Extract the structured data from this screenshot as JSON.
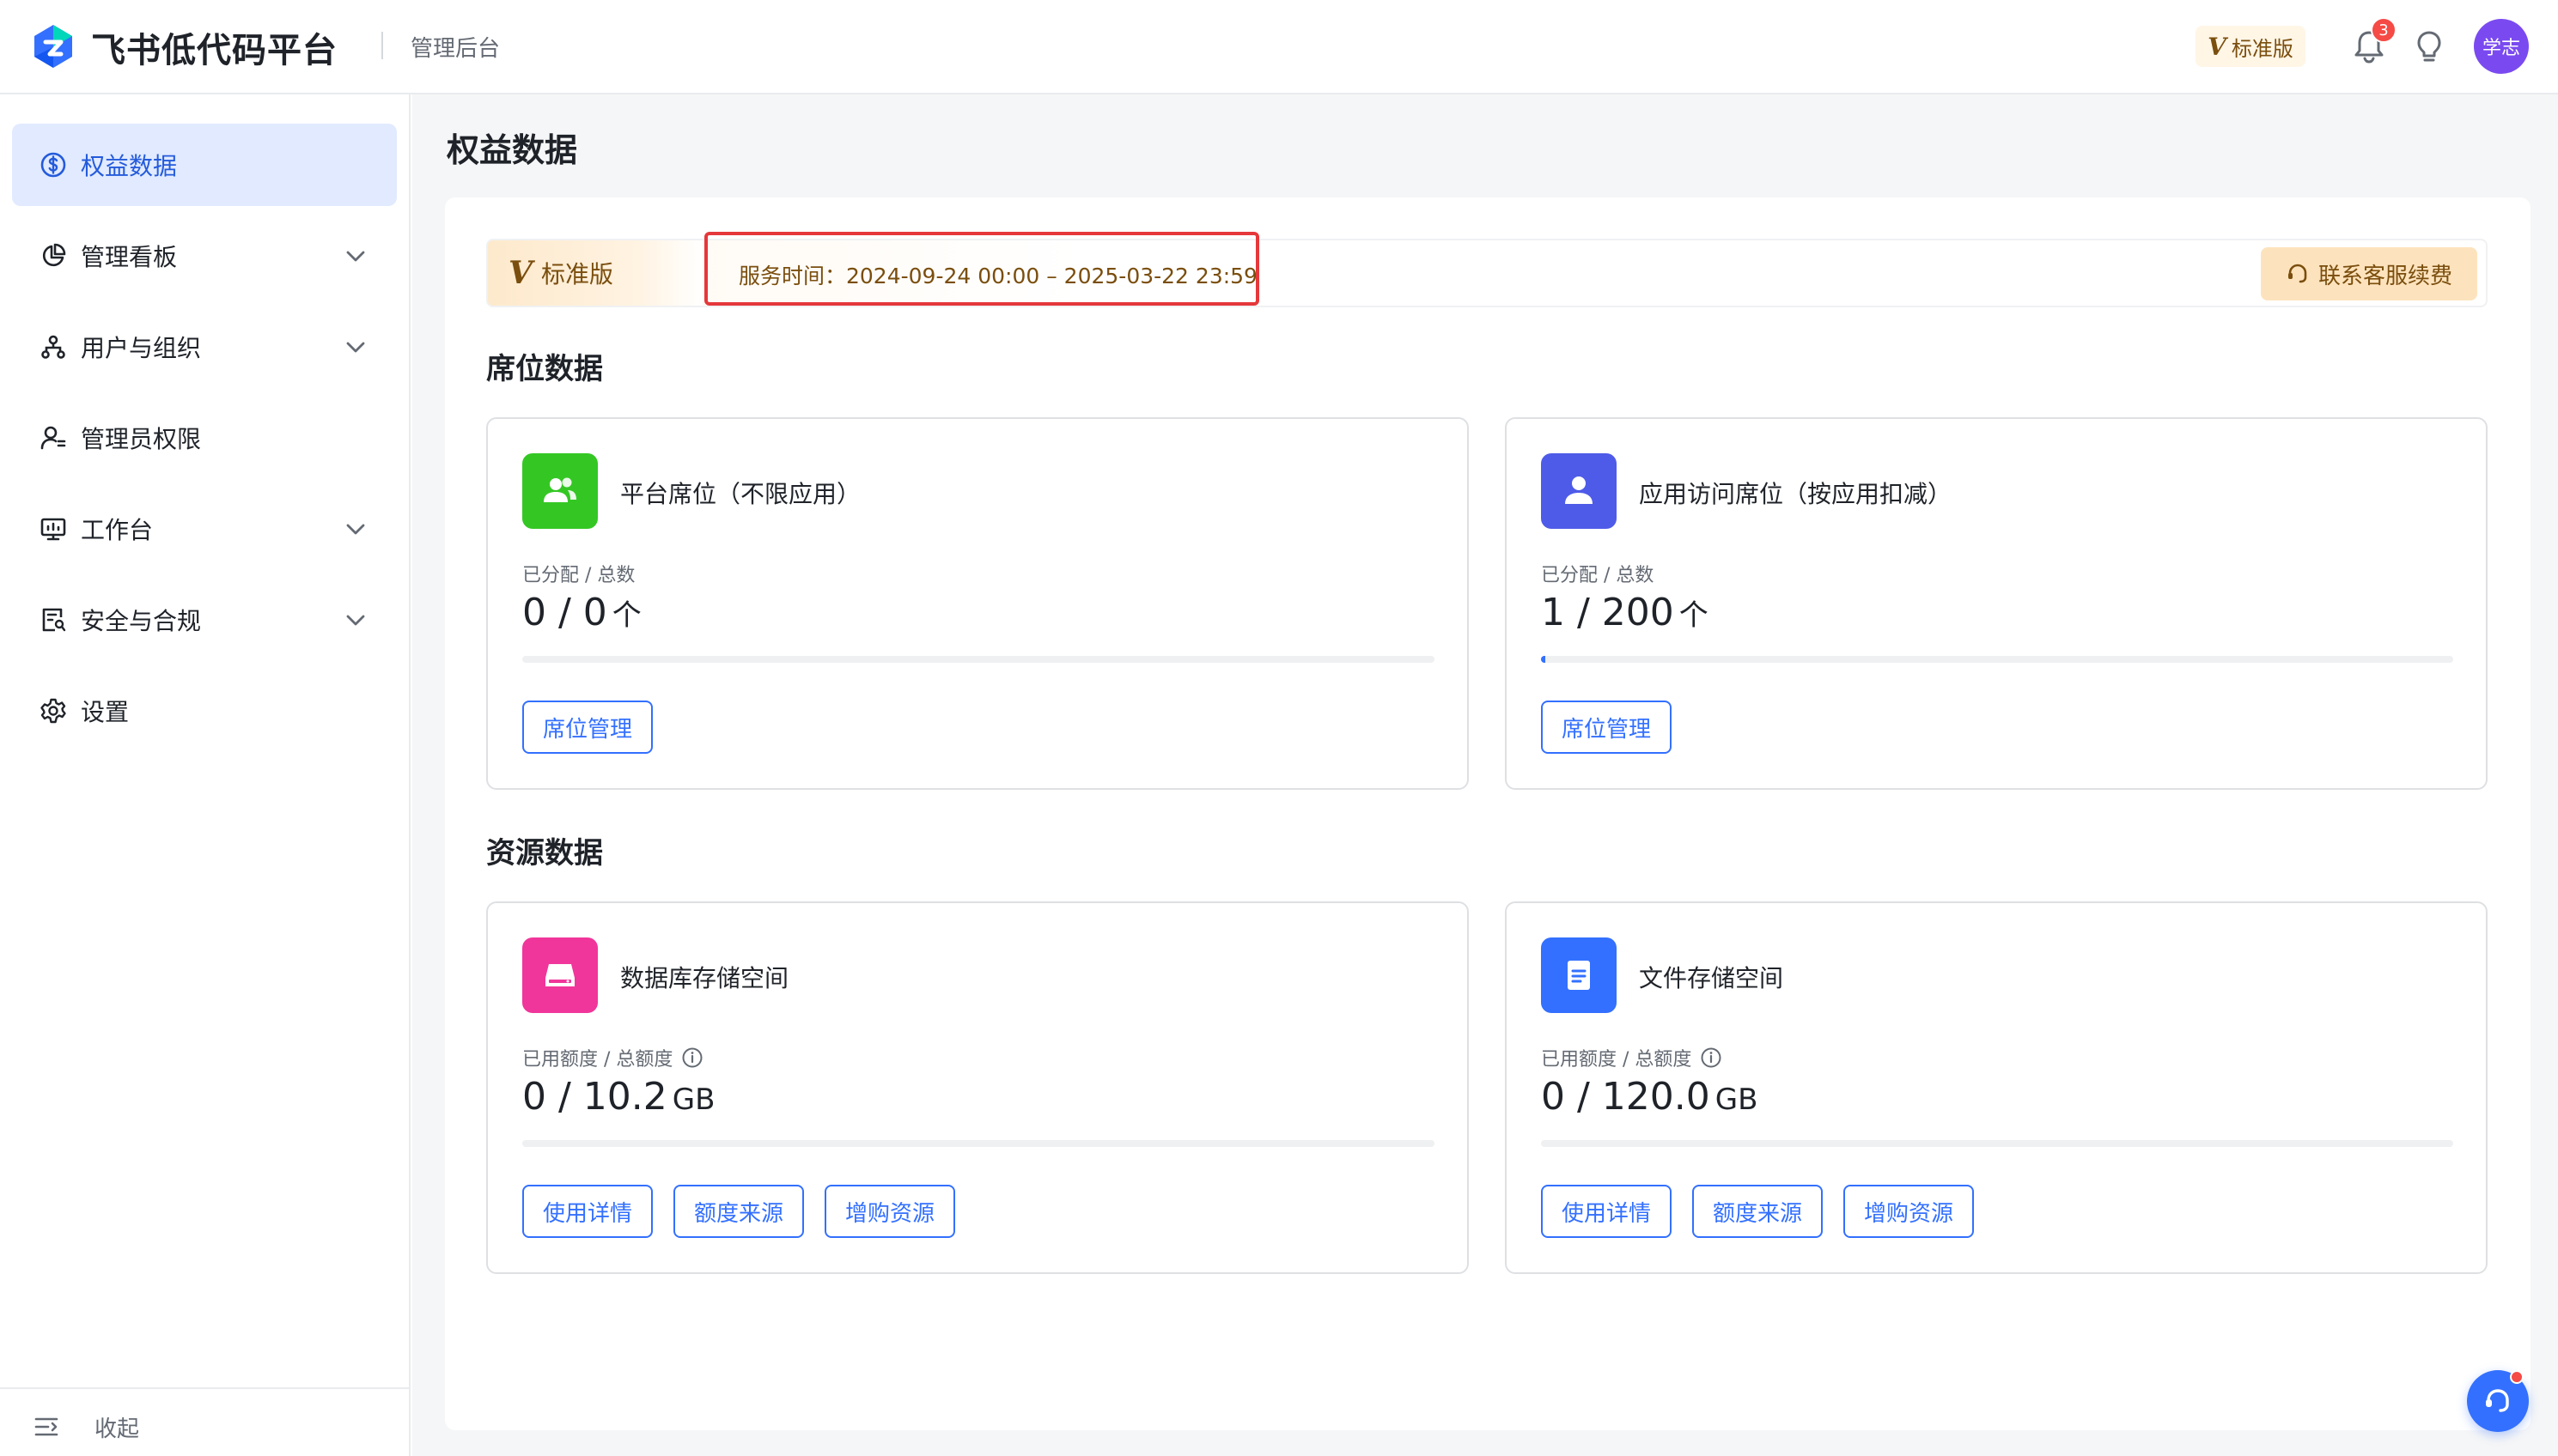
{
  "header": {
    "app_name": "飞书低代码平台",
    "subtitle": "管理后台",
    "edition_label": "标准版",
    "notifications_count": "3",
    "avatar_text": "学志"
  },
  "sidebar": {
    "items": [
      {
        "label": "权益数据",
        "icon": "dollar-circle-icon",
        "active": true,
        "expandable": false
      },
      {
        "label": "管理看板",
        "icon": "pie-chart-icon",
        "active": false,
        "expandable": true
      },
      {
        "label": "用户与组织",
        "icon": "org-tree-icon",
        "active": false,
        "expandable": true
      },
      {
        "label": "管理员权限",
        "icon": "admin-user-icon",
        "active": false,
        "expandable": false
      },
      {
        "label": "工作台",
        "icon": "monitor-icon",
        "active": false,
        "expandable": true
      },
      {
        "label": "安全与合规",
        "icon": "security-doc-icon",
        "active": false,
        "expandable": true
      },
      {
        "label": "设置",
        "icon": "gear-icon",
        "active": false,
        "expandable": false
      }
    ],
    "collapse_label": "收起"
  },
  "page": {
    "title": "权益数据",
    "service": {
      "edition_label": "标准版",
      "time_text": "服务时间：2024-09-24 00:00 – 2025-03-22 23:59",
      "renew_label": "联系客服续费"
    },
    "seat_section": {
      "title": "席位数据",
      "cards": [
        {
          "name": "平台席位（不限应用）",
          "label": "已分配 / 总数",
          "value": "0 / 0",
          "unit": "个",
          "usage_fraction": 0,
          "icon": "users-icon",
          "color": "#34c724",
          "buttons": [
            "席位管理"
          ]
        },
        {
          "name": "应用访问席位（按应用扣减）",
          "label": "已分配 / 总数",
          "value": "1 / 200",
          "unit": "个",
          "usage_fraction": 0.005,
          "icon": "user-icon",
          "color": "#4e5be8",
          "buttons": [
            "席位管理"
          ]
        }
      ]
    },
    "resource_section": {
      "title": "资源数据",
      "cards": [
        {
          "name": "数据库存储空间",
          "label": "已用额度 / 总额度",
          "value": "0 / 10.2",
          "unit": "GB",
          "usage_fraction": 0,
          "icon": "database-icon",
          "color": "#f0369a",
          "buttons": [
            "使用详情",
            "额度来源",
            "增购资源"
          ]
        },
        {
          "name": "文件存储空间",
          "label": "已用额度 / 总额度",
          "value": "0 / 120.0",
          "unit": "GB",
          "usage_fraction": 0,
          "icon": "file-icon",
          "color": "#3370ff",
          "buttons": [
            "使用详情",
            "额度来源",
            "增购资源"
          ]
        }
      ]
    }
  }
}
